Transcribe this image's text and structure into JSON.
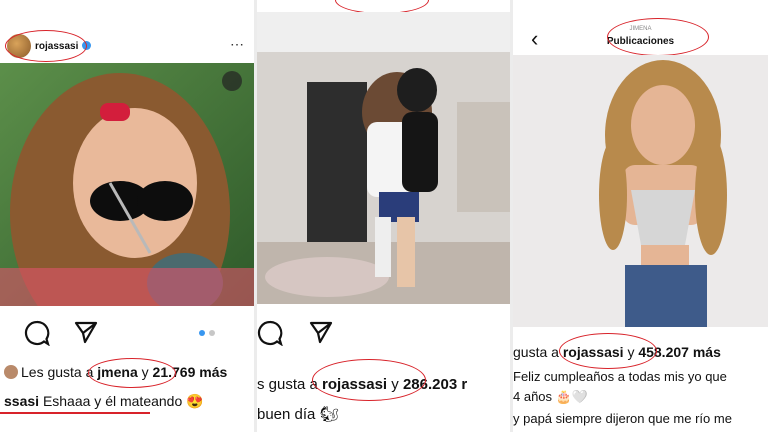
{
  "panel1": {
    "username": "rojassasi",
    "likes_prefix": "Les gusta a",
    "likes_user": "jmena",
    "likes_mid": "y",
    "likes_count": "21.769",
    "likes_suffix": "más",
    "caption_user": "ssasi",
    "caption_text": "Eshaaa y él mateando",
    "caption_emoji": "😍",
    "icons": [
      "comment-icon",
      "share-icon",
      "more-icon",
      "verified-icon"
    ]
  },
  "panel2": {
    "likes_prefix": "s gusta a",
    "likes_user": "rojassasi",
    "likes_mid": "y",
    "likes_count": "286.203",
    "likes_suffix": "r",
    "caption_text": "buen día",
    "caption_emoji": "🐿",
    "icons": [
      "comment-icon",
      "share-icon"
    ]
  },
  "panel3": {
    "header_small": "JIMENA",
    "header_title": "Publicaciones",
    "likes_prefix": "gusta a",
    "likes_user": "rojassasi",
    "likes_mid": "y",
    "likes_count": "458.207",
    "likes_suffix": "más",
    "caption_line1": "Feliz cumpleaños a todas mis yo que",
    "caption_line2": "4 años 🎂🤍",
    "caption_line3": "y papá siempre dijeron que me río me",
    "icons": [
      "back-chevron-icon"
    ]
  },
  "colors": {
    "highlight": "#d8232a",
    "text": "#111111",
    "accent_dot": "#3897f0"
  }
}
